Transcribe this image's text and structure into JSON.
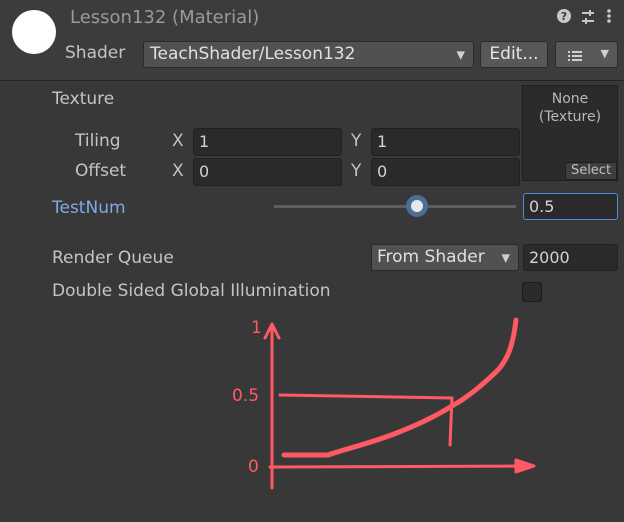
{
  "header": {
    "title": "Lesson132 (Material)",
    "shader_label": "Shader",
    "shader_value": "TeachShader/Lesson132",
    "edit_button": "Edit...",
    "icons": [
      "help-icon",
      "preset-sliders-icon",
      "more-vert-icon",
      "list-menu-icon"
    ]
  },
  "texture": {
    "label": "Texture",
    "slot_text": "None\n(Texture)",
    "select_label": "Select",
    "tiling_label": "Tiling",
    "offset_label": "Offset",
    "x_label": "X",
    "y_label": "Y",
    "tiling_x": "1",
    "tiling_y": "1",
    "offset_x": "0",
    "offset_y": "0"
  },
  "testnum": {
    "label": "TestNum",
    "value": "0.5",
    "slider_fraction": 0.5
  },
  "render_queue": {
    "label": "Render Queue",
    "mode": "From Shader",
    "value": "2000"
  },
  "double_sided": {
    "label": "Double Sided Global Illumination",
    "checked": false
  },
  "annotation": {
    "y_labels": [
      "1",
      "0.5",
      "0"
    ],
    "color": "#ff5a64"
  },
  "colors": {
    "accent": "#4b6f99",
    "focused_label": "#7fa9e8"
  }
}
